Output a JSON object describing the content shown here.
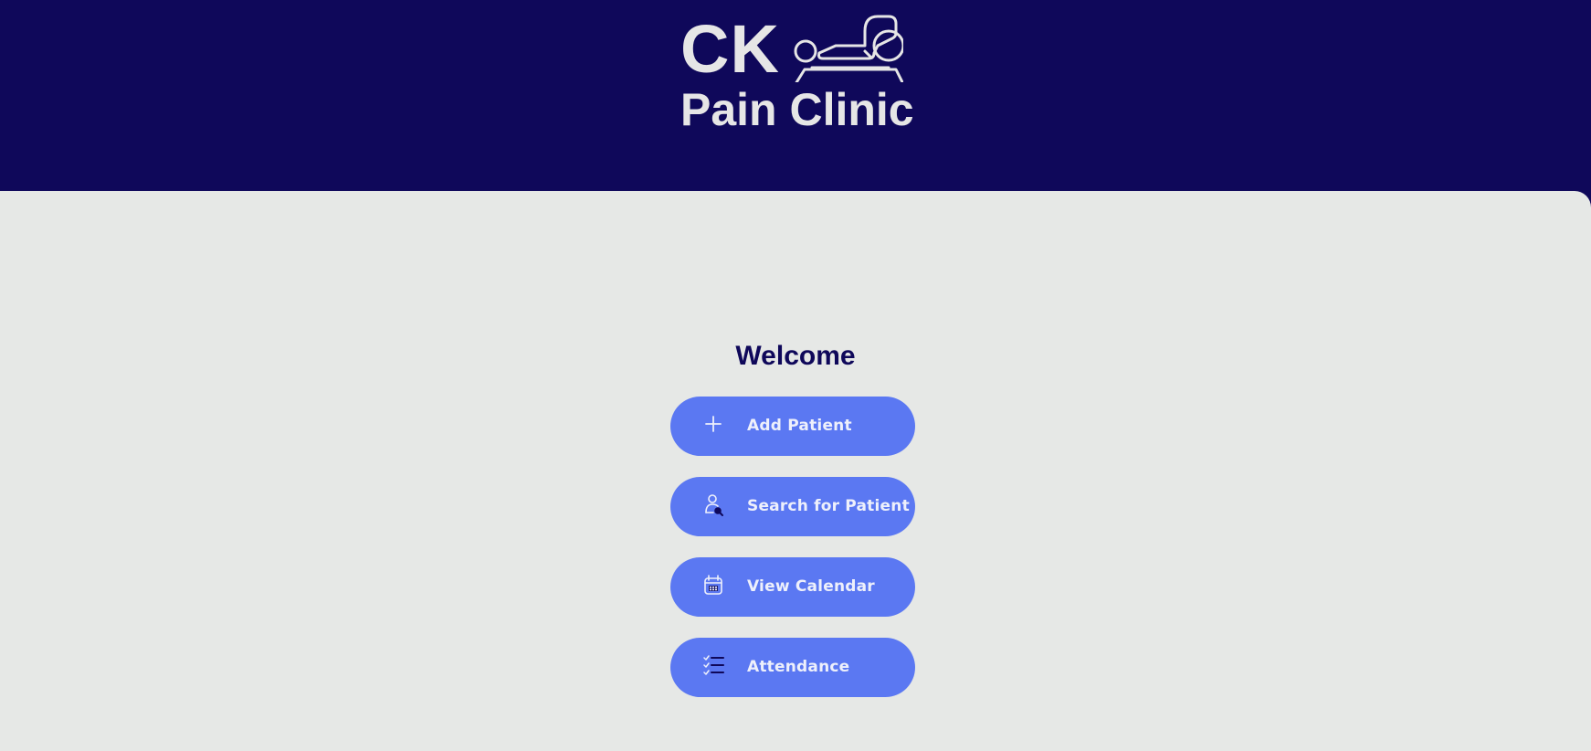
{
  "header": {
    "logo_initials": "CK",
    "logo_subtitle": "Pain Clinic",
    "logo_icon": "patient-on-table-icon"
  },
  "main": {
    "welcome": "Welcome",
    "buttons": [
      {
        "label": "Add Patient",
        "icon": "plus-icon"
      },
      {
        "label": "Search for Patient",
        "icon": "search-user-icon"
      },
      {
        "label": "View Calendar",
        "icon": "calendar-icon"
      },
      {
        "label": "Attendance",
        "icon": "checklist-icon"
      }
    ]
  },
  "colors": {
    "header_bg": "#0f085a",
    "content_bg": "#e6e8e6",
    "button_bg": "#5b78f2",
    "button_text": "#eef0fb",
    "welcome_text": "#0f085a",
    "logo_text": "#e6e6e6"
  }
}
